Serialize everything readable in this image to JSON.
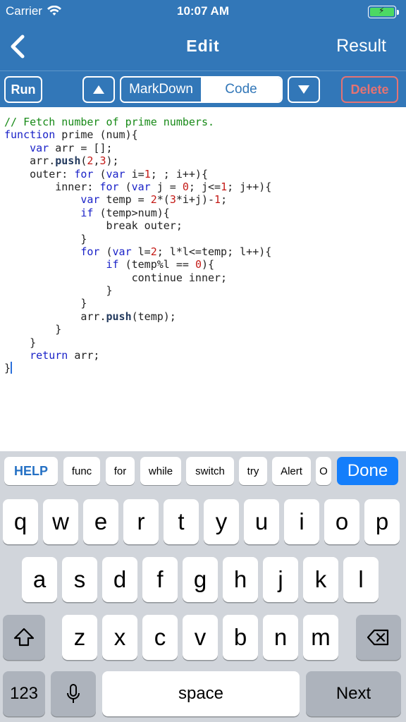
{
  "status": {
    "carrier": "Carrier",
    "time": "10:07 AM"
  },
  "nav": {
    "title": "Edit",
    "right": "Result"
  },
  "toolbar": {
    "run": "Run",
    "seg_left": "MarkDown",
    "seg_right": "Code",
    "delete": "Delete"
  },
  "code": [
    "// Fetch number of prime numbers.",
    "function prime (num){",
    "    var arr = [];",
    "    arr.push(2,3);",
    "    outer: for (var i=1; ; i++){",
    "        inner: for (var j = 0; j<=1; j++){",
    "            var temp = 2*(3*i+j)-1;",
    "            if (temp>num){",
    "                break outer;",
    "            }",
    "            for (var l=2; l*l<=temp; l++){",
    "                if (temp%l == 0){",
    "                    continue inner;",
    "                }",
    "            }",
    "            arr.push(temp);",
    "        }",
    "    }",
    "    return arr;",
    "}"
  ],
  "chips": [
    "HELP",
    "func",
    "for",
    "while",
    "switch",
    "try",
    "Alert",
    "O"
  ],
  "keyboard": {
    "done": "Done",
    "row1": [
      "q",
      "w",
      "e",
      "r",
      "t",
      "y",
      "u",
      "i",
      "o",
      "p"
    ],
    "row2": [
      "a",
      "s",
      "d",
      "f",
      "g",
      "h",
      "j",
      "k",
      "l"
    ],
    "row3": [
      "z",
      "x",
      "c",
      "v",
      "b",
      "n",
      "m"
    ],
    "num": "123",
    "space": "space",
    "next": "Next"
  },
  "colors": {
    "nav": "#3277b8",
    "keyword": "#1a22c8",
    "comment": "#178a17",
    "number": "#c41a16",
    "method": "#233a5e"
  }
}
